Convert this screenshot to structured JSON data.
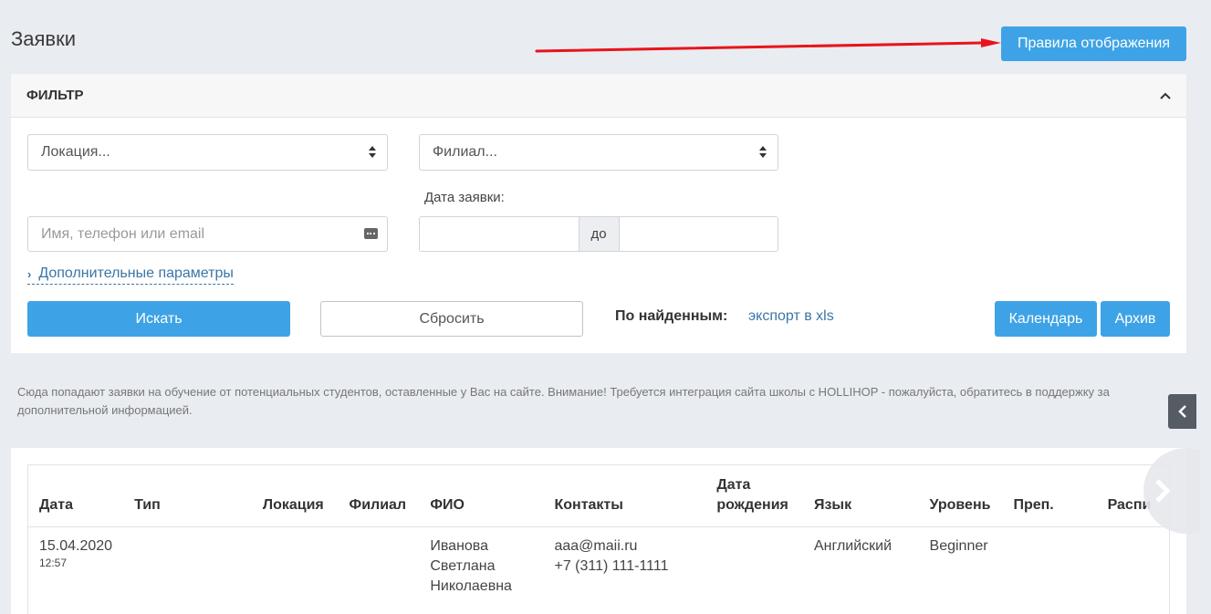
{
  "page": {
    "title": "Заявки"
  },
  "header": {
    "rules_button": "Правила отображения"
  },
  "filter": {
    "title": "ФИЛЬТР",
    "location_placeholder": "Локация...",
    "branch_placeholder": "Филиал...",
    "date_label": "Дата заявки:",
    "search_placeholder": "Имя, телефон или email",
    "date_to": "до",
    "advanced_link": "Дополнительные параметры",
    "search_button": "Искать",
    "reset_button": "Сбросить",
    "found_label": "По найденным:",
    "export_link": "экспорт в xls",
    "calendar_button": "Календарь",
    "archive_button": "Архив"
  },
  "info": "Сюда попадают заявки на обучение от потенциальных студентов, оставленные у Вас на сайте. Внимание! Требуется интеграция сайта школы с HOLLIHOP - пожалуйста, обратитесь в поддержку за дополнительной информацией.",
  "table": {
    "columns": [
      "Дата",
      "Тип",
      "Локация",
      "Филиал",
      "ФИО",
      "Контакты",
      "Дата рождения",
      "Язык",
      "Уровень",
      "Преп.",
      "Распи"
    ],
    "rows": [
      {
        "date": "15.04.2020",
        "time": "12:57",
        "type": "",
        "location": "",
        "branch": "",
        "name": [
          "Иванова",
          "Светлана",
          "Николаевна"
        ],
        "contacts": [
          "aaa@maii.ru",
          "+7 (311) 111-1111"
        ],
        "birth": "",
        "language": "Английский",
        "level": "Beginner",
        "teacher": "",
        "schedule": ""
      }
    ]
  },
  "colors": {
    "primary": "#3ea3e6",
    "link": "#3b76a6",
    "annotation_arrow": "#e8141b"
  }
}
